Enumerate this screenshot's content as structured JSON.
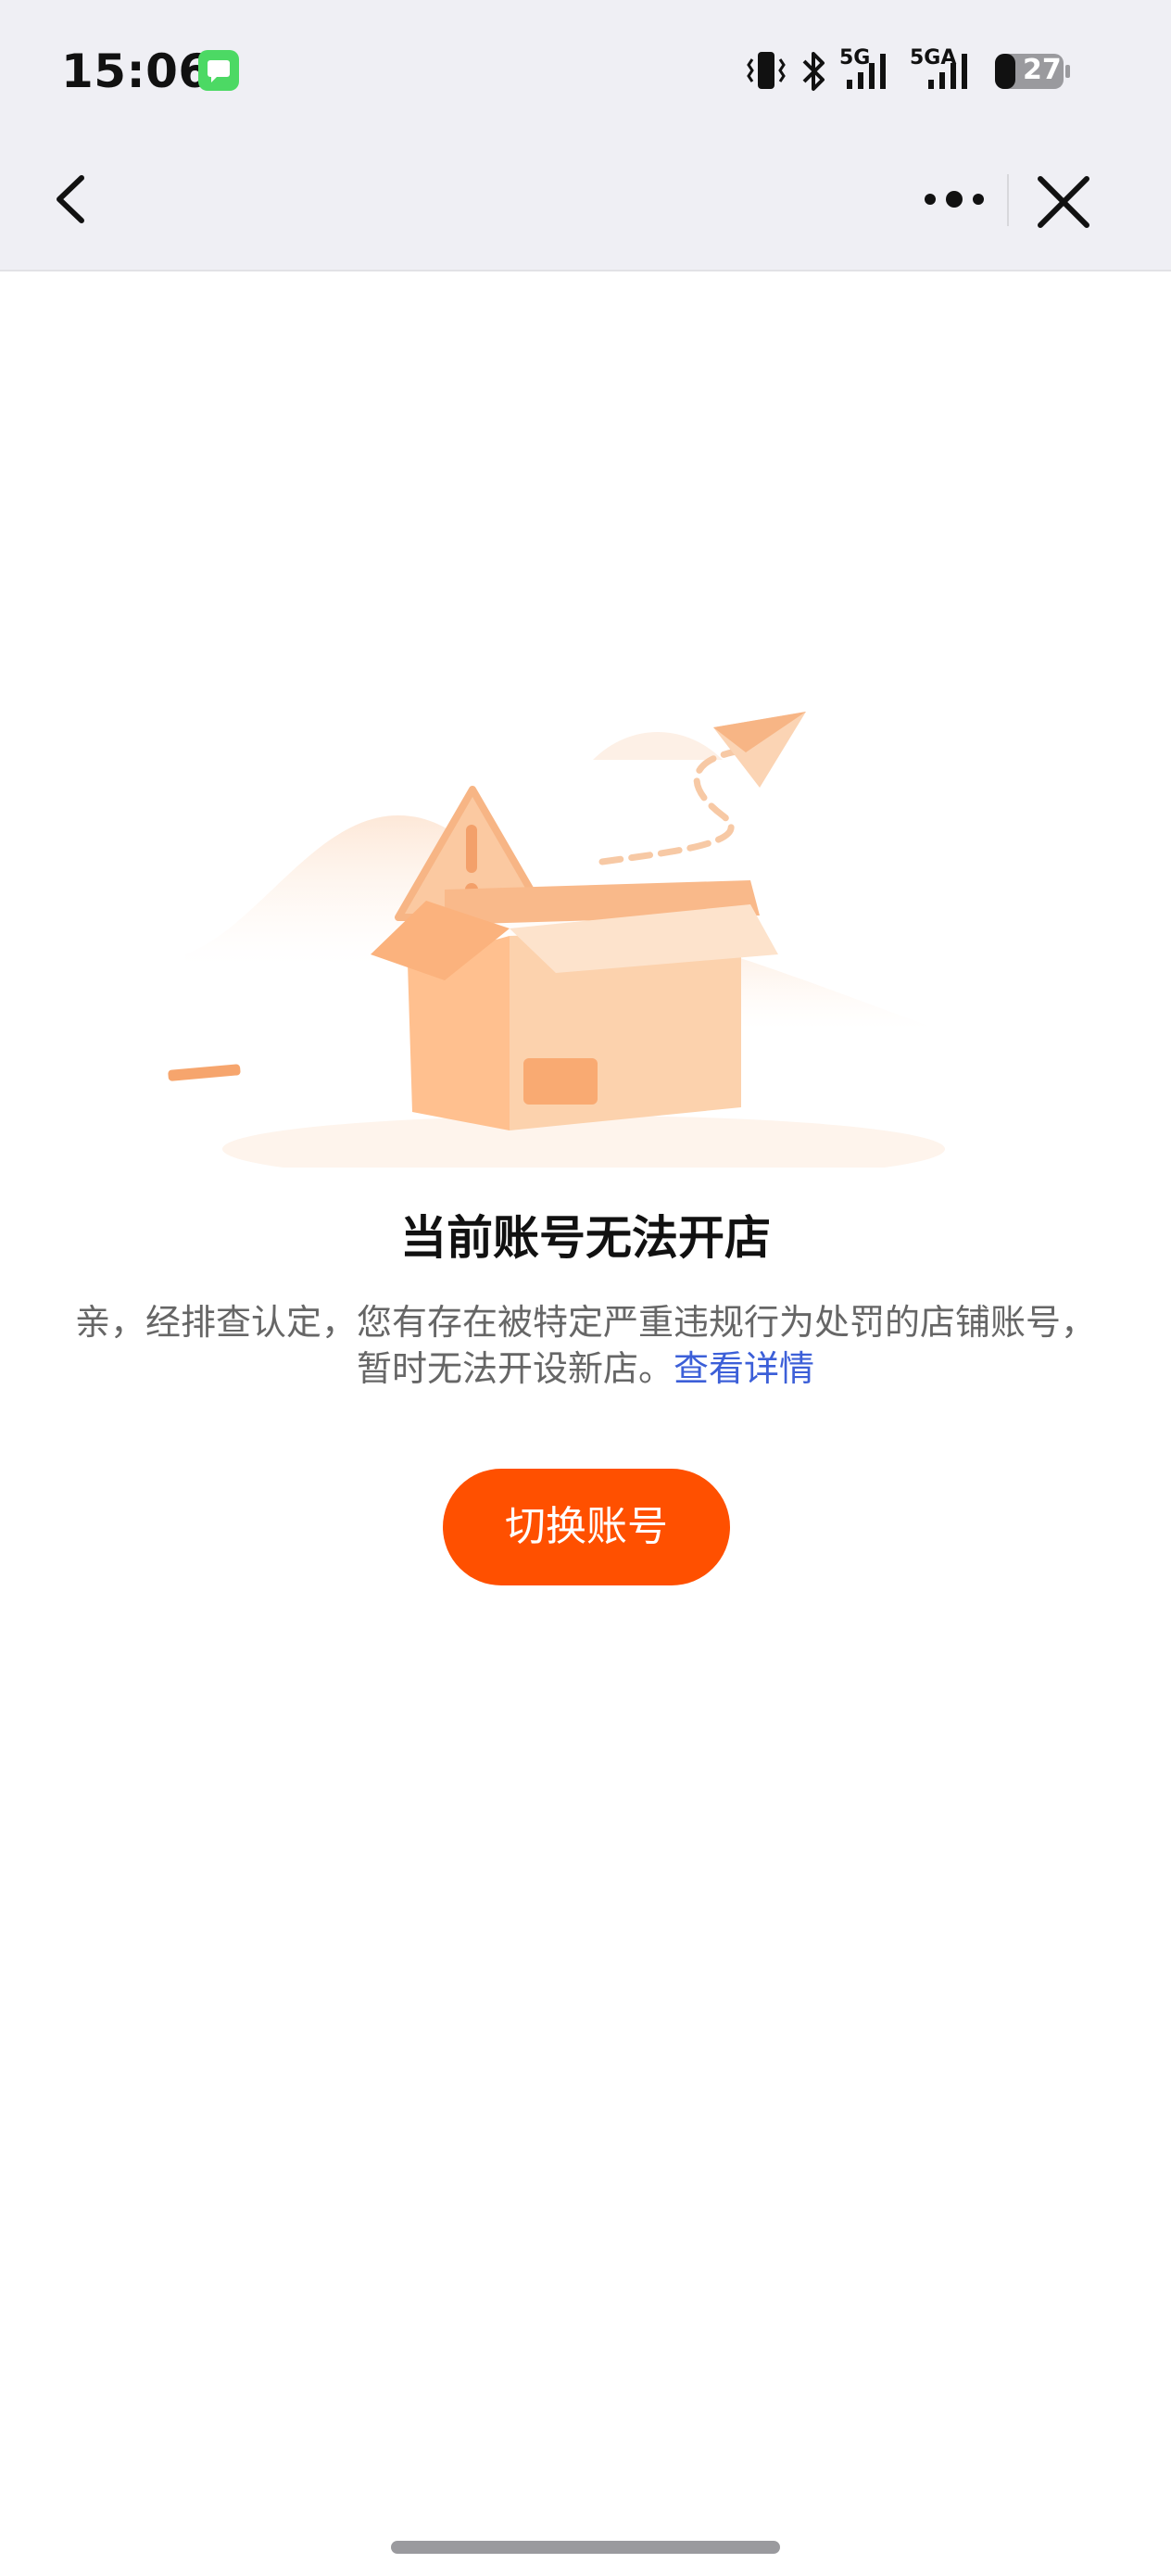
{
  "status_bar": {
    "time": "15:06",
    "network_1": "5G",
    "network_2": "5GA",
    "battery": "27"
  },
  "nav": {
    "back_icon": "chevron-left-icon",
    "more_icon": "more-dots-icon",
    "close_icon": "close-icon"
  },
  "content": {
    "title": "当前账号无法开店",
    "description": "亲，经排查认定，您有存在被特定严重违规行为处罚的店铺账号，暂时无法开设新店。",
    "link": "查看详情",
    "button": "切换账号"
  },
  "colors": {
    "accent": "#ff5000",
    "link": "#3c5fd8",
    "topbar": "#efeff4"
  }
}
